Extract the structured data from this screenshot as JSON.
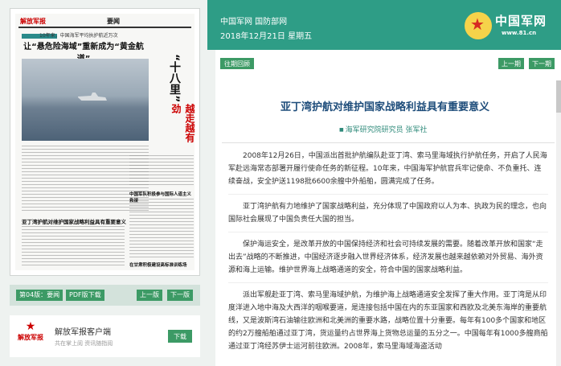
{
  "paper": {
    "logo": "解放军报",
    "section": "要闻",
    "kicker": "10年来，中国海军平均执护航近万次",
    "headline": "让“悬危险海域”重新成为“黄金航道”",
    "vertical_headline": "“十八里”",
    "vertical_sub": "越走越有劲",
    "hl_bottom": "亚丁湾护航对维护国家战略利益具有重要意义",
    "hl_mid": "中国军队积极参与国际人道主义救援",
    "hl_low": "在甘肃积极建设高标准训练场"
  },
  "edition": {
    "page_label": "第04版：要闻",
    "pdf_label": "PDF版下载",
    "prev_label": "上一版",
    "next_label": "下一版"
  },
  "app": {
    "logo_text": "解放军报",
    "title": "解放军报客户端",
    "subtitle": "共在掌上阅 资讯随指阅",
    "download_label": "下载"
  },
  "header": {
    "site": "中国军网 国防部网",
    "date": "2018年12月21日 星期五",
    "logo_text": "中国军网",
    "logo_url": "www.81.cn"
  },
  "toolbar": {
    "history_label": "往期回顾",
    "prev_label": "上一期",
    "next_label": "下一期"
  },
  "article": {
    "title": "亚丁湾护航对维护国家战略利益具有重要意义",
    "author": "海军研究院研究员 张军社",
    "paragraphs": [
      "2008年12月26日，中国派出首批护航编队赴亚丁湾、索马里海域执行护航任务，开启了人民海军赴远海常态部署开履行使命任务的新征程。10年来，中国海军护航官兵牢记使命、不负重托、连续奋战，安全护送1198批6600余艘中外船舶，圆满完成了任务。",
      "亚丁湾护航有力地维护了国家战略利益，充分体现了中国政府以人为本、执政为民的理念，也向国际社会展现了中国负责任大国的担当。",
      "保护海运安全，是改革开放的中国保持经济和社会可持续发展的需要。随着改革开放和国家“走出去”战略的不断推进，中国经济逐步融入世界经济体系，经济发展也越来越依赖对外贸易、海外资源和海上运输。维护世界海上战略通道的安全，符合中国的国家战略利益。",
      "派出军舰赴亚丁湾、索马里海域护航，为维护海上战略通道安全发挥了重大作用。亚丁湾是从印度洋进入地中海及大西洋的咽喉要道，是连接包括中国在内的东亚国家和西欧及北美东海岸的重要航线，又是波斯湾石油输往欧洲和北美洲的重要水路，战略位置十分重要。每年有100多个国家和地区的约2万艘船舶通过亚丁湾，货运量约占世界海上货物总运量的五分之一。中国每年有1000多艘商船通过亚丁湾经苏伊士运河前往欧洲。2008年，索马里海域海盗活动"
    ]
  }
}
